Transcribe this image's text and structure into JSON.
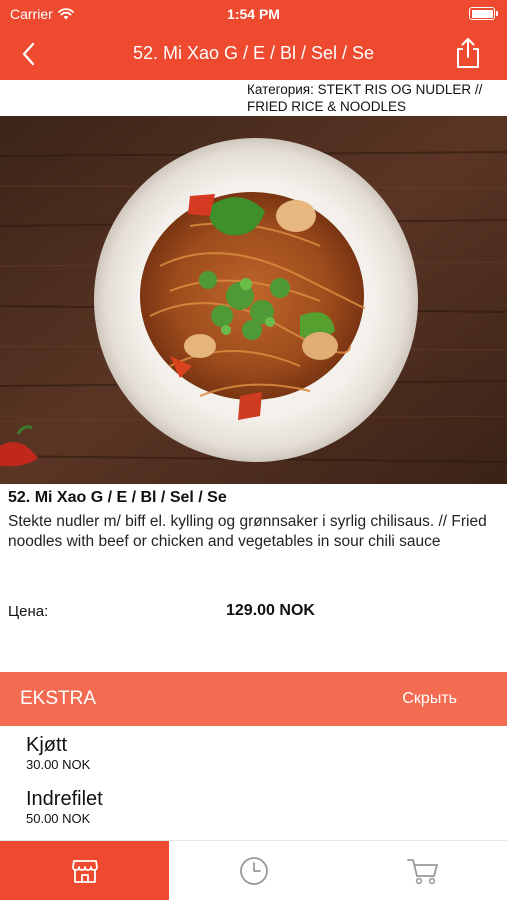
{
  "status_bar": {
    "carrier": "Carrier",
    "time": "1:54 PM"
  },
  "nav": {
    "title": "52. Mi Xao G / E / Bl / Sel / Se",
    "back_icon": "chevron-left-icon",
    "share_icon": "share-icon"
  },
  "category": "Категория: STEKT RIS OG NUDLER // FRIED RICE & NOODLES",
  "dish": {
    "title": "52. Mi Xao G / E / Bl / Sel / Se",
    "description": "Stekte nudler m/ biff el. kylling og grønnsaker i syrlig chilisaus. // Fried\nnoodles with beef or chicken and vegetables in sour chili sauce",
    "price_label": "Цена:",
    "price": "129.00 NOK"
  },
  "extras": {
    "header": "EKSTRA",
    "toggle": "Скрыть",
    "items": [
      {
        "name": "Kjøtt",
        "price": "30.00 NOK"
      },
      {
        "name": "Indrefilet",
        "price": "50.00 NOK"
      }
    ]
  },
  "tabs": [
    {
      "icon": "store-icon",
      "active": true
    },
    {
      "icon": "clock-icon",
      "active": false
    },
    {
      "icon": "cart-icon",
      "active": false
    }
  ],
  "colors": {
    "accent": "#ee4a2f",
    "extra_header": "#f36b50",
    "tab_inactive_icon": "#9a9a9a"
  }
}
